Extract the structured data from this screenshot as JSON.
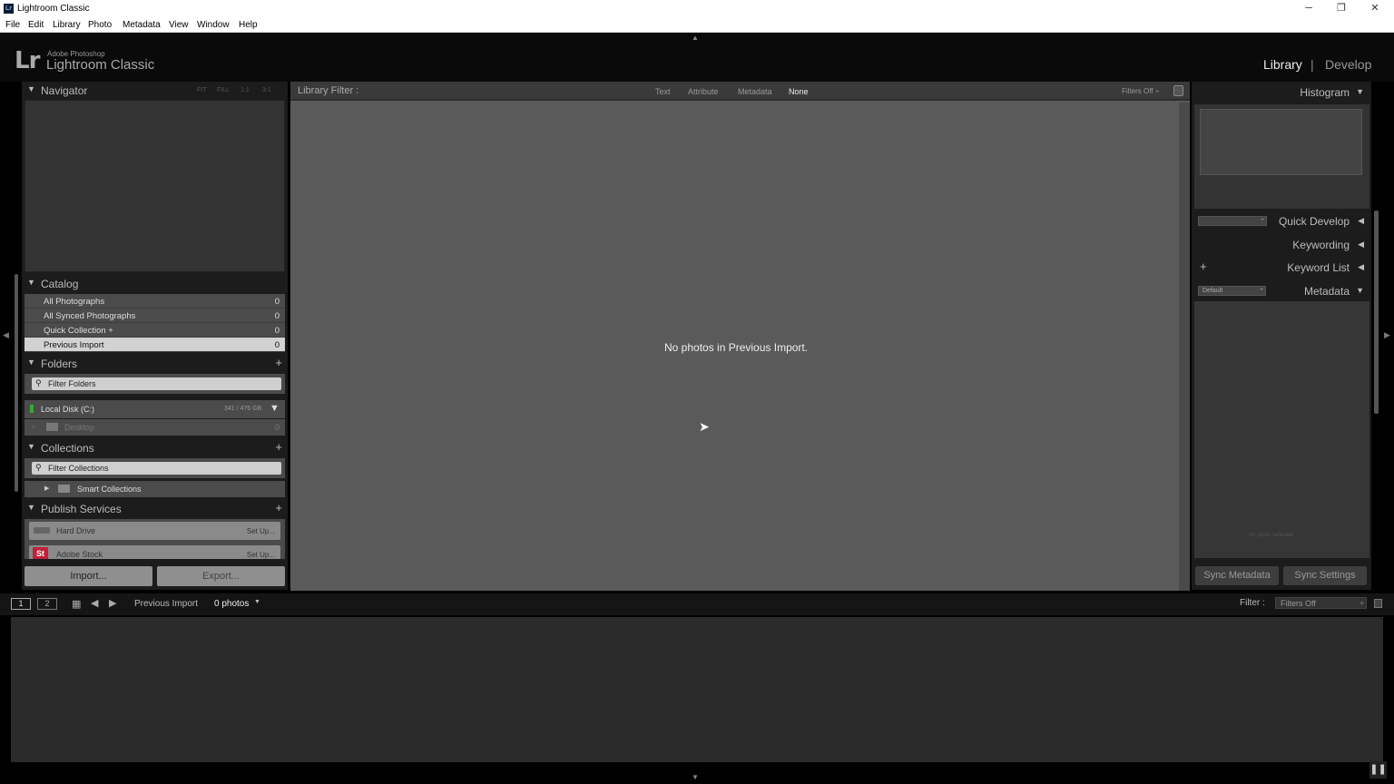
{
  "window": {
    "title": "Lightroom Classic",
    "minimize": "─",
    "restore": "❐",
    "close": "✕"
  },
  "menu": [
    "File",
    "Edit",
    "Library",
    "Photo",
    "Metadata",
    "View",
    "Window",
    "Help"
  ],
  "brand": {
    "logo": "Lr",
    "small": "Adobe Photoshop",
    "big": "Lightroom Classic"
  },
  "modules": {
    "library": "Library",
    "separator": "|",
    "develop": "Develop"
  },
  "navigator": {
    "title": "Navigator",
    "zoom": [
      "FIT",
      "FILL",
      "1:1",
      "3:1"
    ]
  },
  "catalog": {
    "title": "Catalog",
    "items": [
      {
        "name": "All Photographs",
        "count": "0"
      },
      {
        "name": "All Synced Photographs",
        "count": "0"
      },
      {
        "name": "Quick Collection +",
        "count": "0"
      },
      {
        "name": "Previous Import",
        "count": "0"
      }
    ]
  },
  "folders": {
    "title": "Folders",
    "filter_placeholder": "Filter Folders",
    "disk_name": "Local Disk (C:)",
    "disk_size": "341 / 476 GB",
    "sub_folder": "Desktop",
    "sub_count": "0"
  },
  "collections": {
    "title": "Collections",
    "filter_placeholder": "Filter Collections",
    "smart": "Smart Collections"
  },
  "publish": {
    "title": "Publish Services",
    "items": [
      {
        "name": "Hard Drive",
        "setup": "Set Up..."
      },
      {
        "name": "Adobe Stock",
        "setup": "Set Up..."
      }
    ]
  },
  "buttons": {
    "import": "Import...",
    "export": "Export...",
    "sync_metadata": "Sync Metadata",
    "sync_settings": "Sync Settings"
  },
  "library_filter": {
    "label": "Library Filter :",
    "options": [
      "Text",
      "Attribute",
      "Metadata",
      "None"
    ],
    "status": "Filters Off ÷"
  },
  "center": {
    "message": "No photos in Previous Import."
  },
  "right": {
    "histogram": "Histogram",
    "quick_develop": "Quick Develop",
    "keywording": "Keywording",
    "keyword_list": "Keyword List",
    "metadata": "Metadata",
    "metadata_preset": "Default",
    "no_photo": "No photo selected"
  },
  "filmstrip": {
    "page1": "1",
    "page2": "2",
    "source": "Previous Import",
    "count": "0 photos",
    "filter_label": "Filter :",
    "filter_value": "Filters Off"
  }
}
